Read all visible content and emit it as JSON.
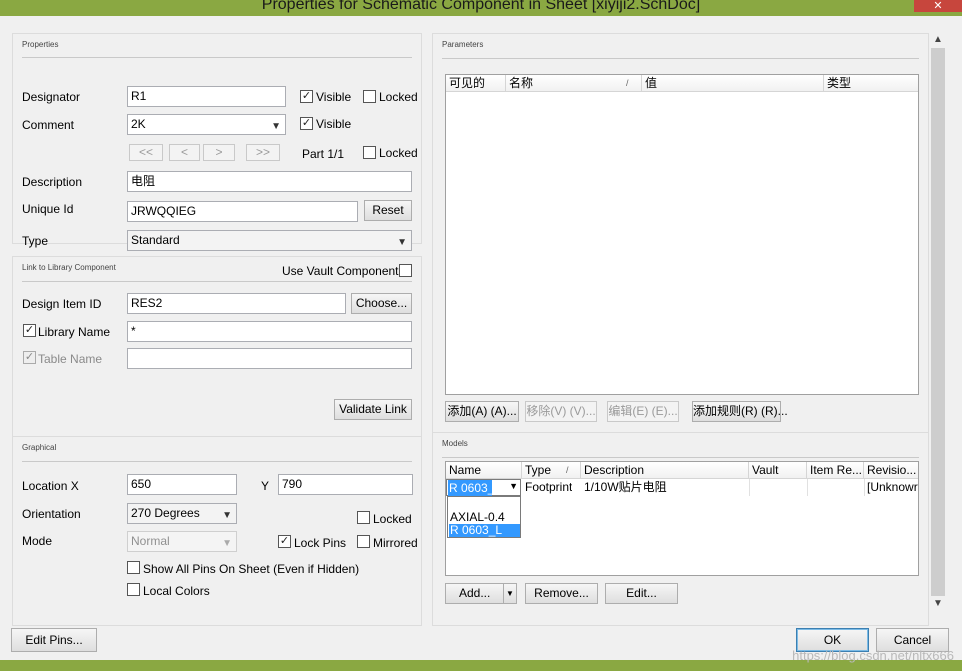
{
  "window": {
    "title": "Properties for Schematic Component in Sheet [xiyiji2.SchDoc]",
    "close_glyph": "✕"
  },
  "properties": {
    "group_title": "Properties",
    "designator_label": "Designator",
    "designator_value": "R1",
    "comment_label": "Comment",
    "comment_value": "2K",
    "visible_label": "Visible",
    "locked_label": "Locked",
    "nav_first": "<<",
    "nav_prev": "<",
    "nav_next": ">",
    "nav_last": ">>",
    "part_label": "Part 1/1",
    "description_label": "Description",
    "description_value": "电阻",
    "unique_id_label": "Unique Id",
    "unique_id_value": "JRWQQIEG",
    "reset_label": "Reset",
    "type_label": "Type",
    "type_value": "Standard"
  },
  "library_link": {
    "group_title": "Link to Library Component",
    "use_vault_label": "Use Vault Component",
    "design_item_label": "Design Item ID",
    "design_item_value": "RES2",
    "choose_label": "Choose...",
    "library_name_label": "Library Name",
    "library_name_value": "*",
    "table_name_label": "Table Name",
    "table_name_value": "",
    "validate_label": "Validate Link"
  },
  "graphical": {
    "group_title": "Graphical",
    "location_x_label": "Location  X",
    "location_x_value": "650",
    "location_y_label": "Y",
    "location_y_value": "790",
    "orientation_label": "Orientation",
    "orientation_value": "270 Degrees",
    "locked_label": "Locked",
    "mode_label": "Mode",
    "mode_value": "Normal",
    "lock_pins_label": "Lock Pins",
    "mirrored_label": "Mirrored",
    "show_all_pins_label": "Show All Pins On Sheet (Even if Hidden)",
    "local_colors_label": "Local Colors"
  },
  "parameters": {
    "group_title": "Parameters",
    "columns": [
      "可见的",
      "名称",
      "值",
      "类型"
    ],
    "sort_glyph": "/",
    "add_label": "添加(A) (A)...",
    "remove_label": "移除(V) (V)...",
    "edit_label": "编辑(E) (E)...",
    "add_rule_label": "添加规则(R) (R)..."
  },
  "models": {
    "group_title": "Models",
    "columns": [
      "Name",
      "Type",
      "Description",
      "Vault",
      "Item Re...",
      "Revisio..."
    ],
    "sort_glyph": "/",
    "row": {
      "name": "R 0603_L",
      "type": "Footprint",
      "description": "1/10W贴片电阻",
      "revision": "[Unknowr"
    },
    "dropdown_options": [
      "AXIAL-0.4",
      "R 0603_L"
    ],
    "add_label": "Add...",
    "remove_label": "Remove...",
    "edit_label": "Edit..."
  },
  "footer": {
    "edit_pins_label": "Edit Pins...",
    "ok_label": "OK",
    "cancel_label": "Cancel"
  },
  "watermark": "https://blog.csdn.net/nltx666"
}
